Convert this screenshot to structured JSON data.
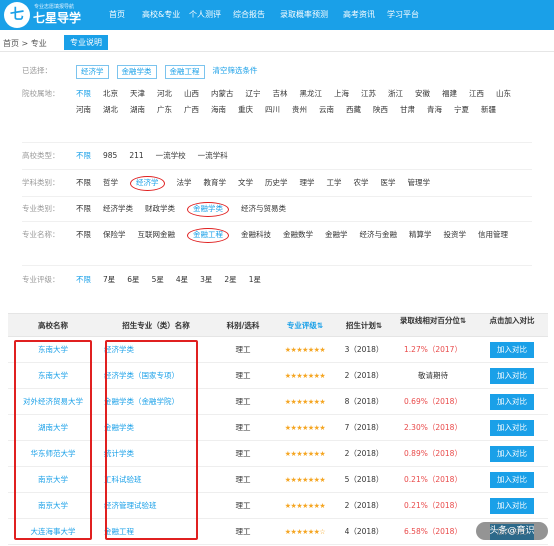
{
  "nav": {
    "logo_glyph": "七",
    "brand_sub": "专业志愿填报导航",
    "brand": "七星导学",
    "items": [
      "首页",
      "高校&专业",
      "个人测评",
      "综合报告",
      "录取概率预测",
      "高考资讯",
      "学习平台"
    ]
  },
  "breadcrumb": {
    "text": "首页 > 专业",
    "button": "专业说明"
  },
  "filters": {
    "selected_label": "已选择：",
    "selected_tags": [
      "经济学",
      "金融学类",
      "金融工程"
    ],
    "clear_label": "清空筛选条件",
    "region_label": "院校属地：",
    "regions": [
      "不限",
      "北京",
      "天津",
      "河北",
      "山西",
      "内蒙古",
      "辽宁",
      "吉林",
      "黑龙江",
      "上海",
      "江苏",
      "浙江",
      "安徽",
      "福建",
      "江西",
      "山东",
      "河南",
      "湖北",
      "湖南",
      "广东",
      "广西",
      "海南",
      "重庆",
      "四川",
      "贵州",
      "云南",
      "西藏",
      "陕西",
      "甘肃",
      "青海",
      "宁夏",
      "新疆"
    ],
    "category_label": "高校类型：",
    "categories": [
      "不限",
      "985",
      "211",
      "一流学校",
      "一流学科"
    ],
    "discipline_label": "学科类别：",
    "disciplines": [
      "不限",
      "哲学",
      "经济学",
      "法学",
      "教育学",
      "文学",
      "历史学",
      "理学",
      "工学",
      "农学",
      "医学",
      "管理学"
    ],
    "major_class_label": "专业类别：",
    "major_classes": [
      "不限",
      "经济学类",
      "财政学类",
      "金融学类",
      "经济与贸易类"
    ],
    "major_name_label": "专业名称：",
    "major_names": [
      "不限",
      "保险学",
      "互联网金融",
      "金融工程",
      "金融科技",
      "金融数学",
      "金融学",
      "经济与金融",
      "精算学",
      "投资学",
      "信用管理"
    ],
    "rating_label": "专业评级：",
    "ratings": [
      "不限",
      "7星",
      "6星",
      "5星",
      "4星",
      "3星",
      "2星",
      "1星"
    ]
  },
  "table": {
    "headers": [
      "高校名称",
      "招生专业（类）名称",
      "科别/选科",
      "专业评级⇅",
      "招生计划⇅",
      "录取线相对百分位⇅",
      "点击加入对比"
    ],
    "add_label": "加入对比",
    "rows": [
      {
        "school": "东南大学",
        "major": "经济学类",
        "subject": "理工",
        "stars": "★★★★★★★",
        "plan": "3（2018）",
        "pct": "1.27%（2017）",
        "pct_red": true
      },
      {
        "school": "东南大学",
        "major": "经济学类（国家专项）",
        "subject": "理工",
        "stars": "★★★★★★★",
        "plan": "2（2018）",
        "pct": "敬请期待",
        "pct_red": false
      },
      {
        "school": "对外经济贸易大学",
        "major": "金融学类（金融学院）",
        "subject": "理工",
        "stars": "★★★★★★★",
        "plan": "8（2018）",
        "pct": "0.69%（2018）",
        "pct_red": true
      },
      {
        "school": "湖南大学",
        "major": "金融学类",
        "subject": "理工",
        "stars": "★★★★★★★",
        "plan": "7（2018）",
        "pct": "2.30%（2018）",
        "pct_red": true
      },
      {
        "school": "华东师范大学",
        "major": "统计学类",
        "subject": "理工",
        "stars": "★★★★★★★",
        "plan": "2（2018）",
        "pct": "0.89%（2018）",
        "pct_red": true
      },
      {
        "school": "南京大学",
        "major": "工科试验班",
        "subject": "理工",
        "stars": "★★★★★★★",
        "plan": "5（2018）",
        "pct": "0.21%（2018）",
        "pct_red": true
      },
      {
        "school": "南京大学",
        "major": "经济管理试验班",
        "subject": "理工",
        "stars": "★★★★★★★",
        "plan": "2（2018）",
        "pct": "0.21%（2018）",
        "pct_red": true
      },
      {
        "school": "大连海事大学",
        "major": "金融工程",
        "subject": "理工",
        "stars": "★★★★★★☆",
        "plan": "4（2018）",
        "pct": "6.58%（2018）",
        "pct_red": true
      }
    ]
  },
  "watermark": "头条@育识",
  "colors": {
    "accent": "#1aa0e8",
    "highlight": "#e02020",
    "star": "#f5a623"
  }
}
